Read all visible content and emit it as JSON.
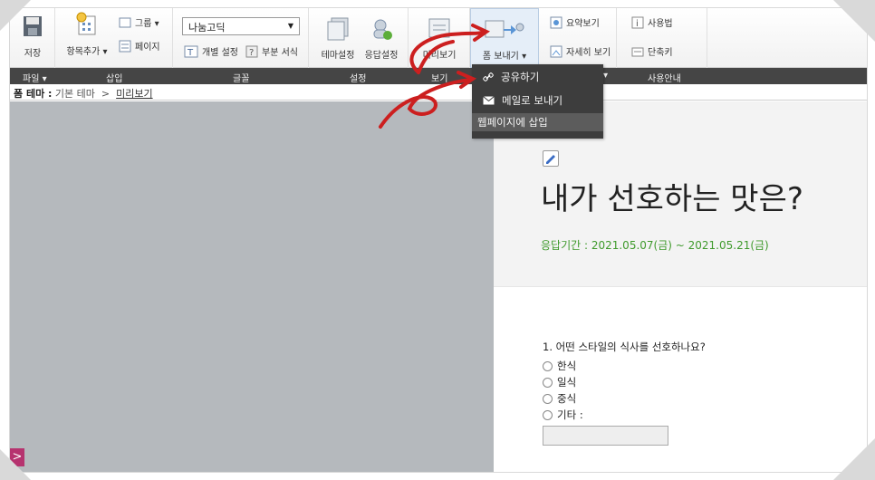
{
  "toolbar": {
    "save": "저장",
    "add_item": "항목추가 ▾",
    "group": "그룹 ▾",
    "page": "페이지",
    "font_select": "나눔고딕",
    "individual_settings": "개별 설정",
    "partial_style": "부분 서식",
    "theme_settings": "테마설정",
    "response_settings": "응답설정",
    "preview": "미리보기",
    "send_form": "폼 보내기 ▾",
    "summary_view": "요약보기",
    "detail_view": "자세히 보기",
    "how_to_use": "사용법",
    "shortcuts": "단축키"
  },
  "categories": {
    "file": "파일 ▾",
    "insert": "삽입",
    "font": "글꼴",
    "settings": "설정",
    "view": "보기",
    "arrow": "▾",
    "guide": "사용안내"
  },
  "breadcrumb": {
    "label": "폼 테마 :",
    "theme": "기본 테마",
    "sep": ">",
    "current": "미리보기"
  },
  "dropdown": {
    "share": "공유하기",
    "email": "메일로 보내기",
    "embed": "웹페이지에 삽입"
  },
  "form": {
    "title": "내가 선호하는 맛은?",
    "period": "응답기간 : 2021.05.07(금) ~ 2021.05.21(금)",
    "question": "1. 어떤 스타일의 식사를 선호하나요?",
    "options": [
      "한식",
      "일식",
      "중식",
      "기타 :"
    ]
  },
  "left_toggle": ">",
  "colors": {
    "accent_green": "#3f9a2c",
    "annotation_red": "#cc1f1f",
    "toggle_pink": "#b6336f",
    "category_bar": "#454545"
  }
}
